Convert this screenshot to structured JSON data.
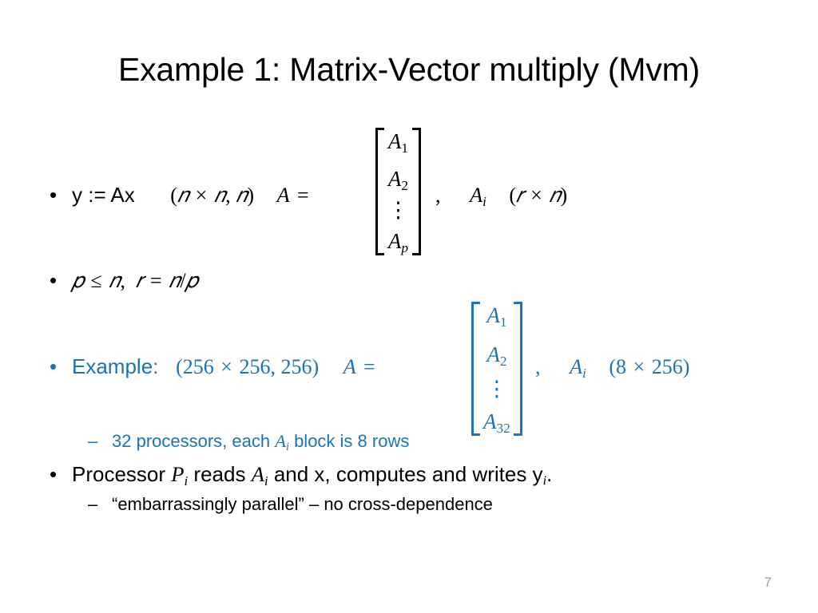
{
  "slide": {
    "title": "Example 1: Matrix-Vector multiply (Mvm)",
    "page_number": "7",
    "accent_color": "#1B74B4",
    "text_color": "#000000",
    "background_color": "#FFFFFF",
    "page_number_color": "#9A9A9A"
  },
  "bullets": {
    "b1": {
      "marker": "•",
      "lead": "y := Ax",
      "dims": "(𝑛 × 𝑛, 𝑛)",
      "dims_plain": "(n × n, n)",
      "assign_var": "A",
      "assign_eq": "=",
      "comma": ",",
      "block_var": "A",
      "block_sub": "i",
      "block_dims": "(r × n)",
      "matrix": {
        "entries": [
          "A",
          "A",
          "⋮",
          "A"
        ],
        "subscripts": [
          "1",
          "2",
          "",
          "p"
        ],
        "rows": [
          "A₁",
          "A₂",
          "⋮",
          "Aₚ"
        ]
      }
    },
    "b2": {
      "marker": "•",
      "text_plain": "p ≤ n,  r = n/p",
      "part1_var": "p",
      "part1_rel": "≤",
      "part1_var2": "n",
      "part1_comma": ",",
      "part2_var": "r",
      "part2_eq": "=",
      "part2_expr": "n/p"
    },
    "b3": {
      "marker": "•",
      "label": "Example:",
      "dims": "(256 × 256, 256)",
      "assign_var": "A",
      "assign_eq": "=",
      "comma": ",",
      "block_var": "A",
      "block_sub": "i",
      "block_dims": "(8 × 256)",
      "matrix": {
        "entries": [
          "A",
          "A",
          "⋮",
          "A"
        ],
        "subscripts": [
          "1",
          "2",
          "",
          "32"
        ],
        "rows": [
          "A₁",
          "A₂",
          "⋮",
          "A₃₂"
        ]
      }
    },
    "b3_sub": {
      "marker": "–",
      "pre": "32 processors, each ",
      "var": "A",
      "var_sub": "i",
      "post": " block is 8 rows"
    },
    "b4": {
      "marker": "•",
      "pre": "Processor ",
      "var1": "P",
      "var1_sub": "i",
      "mid": " reads ",
      "var2": "A",
      "var2_sub": "i",
      "post": " and x, computes and writes y",
      "tail_sub": "i",
      "period": "."
    },
    "b4_sub": {
      "marker": "–",
      "text": "“embarrassingly parallel” – no cross-dependence"
    }
  }
}
